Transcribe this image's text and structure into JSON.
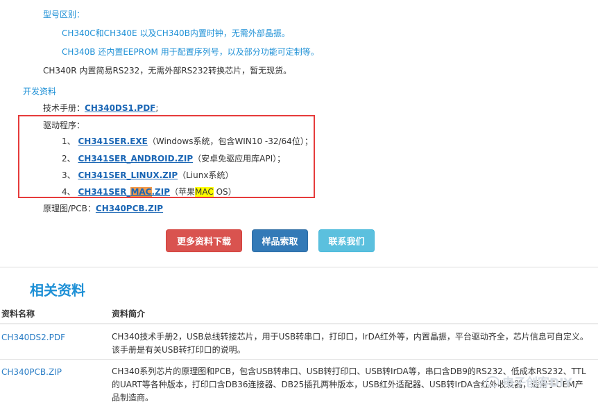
{
  "model_section": {
    "heading": "型号区别：",
    "lines": [
      "CH340C和CH340E 以及CH340B内置时钟，无需外部晶振。",
      "CH340B 还内置EEPROM 用于配置序列号，以及部分功能可定制等。",
      "CH340R 内置简易RS232，无需外部RS232转换芯片，暂无现货。"
    ]
  },
  "dev_section": {
    "heading": "开发资料",
    "manual_label": "技术手册：",
    "manual_link": "CH340DS1.PDF",
    "manual_suffix": ";",
    "driver_label": "驱动程序：",
    "drivers": [
      {
        "num": "1、",
        "link": "CH341SER.EXE",
        "desc": "（Windows系统，包含WIN10 -32/64位）；"
      },
      {
        "num": "2、",
        "link": "CH341SER_ANDROID.ZIP",
        "desc": "（安卓免驱应用库API）；"
      },
      {
        "num": "3、",
        "link": "CH341SER_LINUX.ZIP",
        "desc": "（Liunx系统）"
      },
      {
        "num": "4、",
        "link_pre": "CH341SER_",
        "link_hl": "MAC",
        "link_post": ".ZIP",
        "desc_pre": "（苹果",
        "desc_hl": "MAC",
        "desc_post": " OS）"
      }
    ],
    "schematic_label": "原理图/PCB：",
    "schematic_link": "CH340PCB.ZIP"
  },
  "buttons": {
    "more": "更多资料下载",
    "sample": "样品索取",
    "contact": "联系我们"
  },
  "colors": {
    "accent": "#1e90d6",
    "link": "#1a66b5",
    "highlight_box": "#e63b3b",
    "btn_red": "#d9534f",
    "btn_blue": "#337ab7",
    "btn_cyan": "#5bc0de"
  },
  "related": {
    "title": "相关资料",
    "columns": [
      "资料名称",
      "资料简介"
    ],
    "rows": [
      {
        "name": "CH340DS2.PDF",
        "desc": "CH340技术手册2，USB总线转接芯片，用于USB转串口，打印口，IrDA红外等，内置晶振，平台驱动齐全，芯片信息可自定义。该手册是有关USB转打印口的说明。"
      },
      {
        "name": "CH340PCB.ZIP",
        "desc": "CH340系列芯片的原理图和PCB，包含USB转串口、USB转打印口、USB转IrDA等，串口含DB9的RS232、低成本RS232、TTL的UART等各种版本，打印口含DB36连接器、DB25插孔两种版本，USB红外适配器、USB转IrDA含红外收发器，适用于OEM产品制造商。"
      }
    ]
  },
  "watermark": {
    "text": "电子创客DIY",
    "icon": "wechat-icon"
  }
}
